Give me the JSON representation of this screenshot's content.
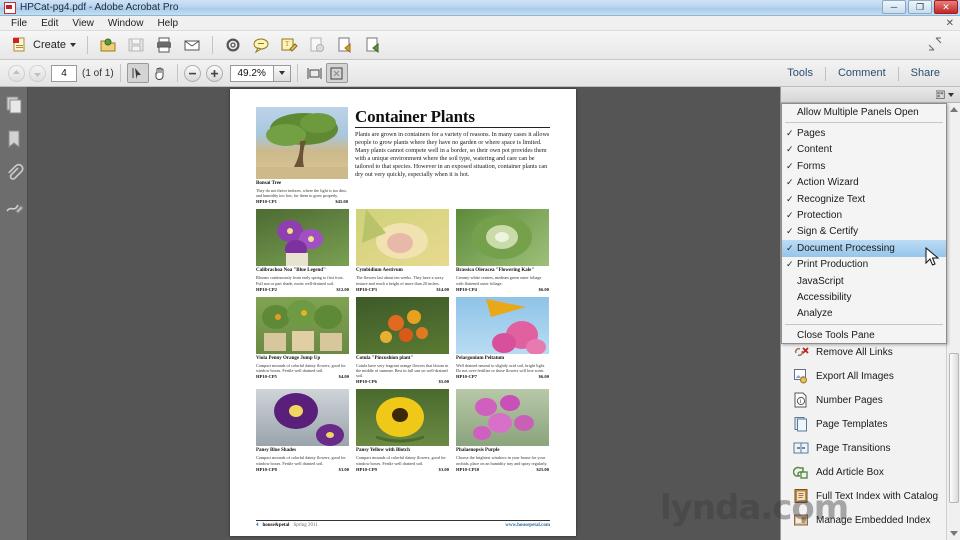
{
  "window": {
    "title": "HPCat-pg4.pdf - Adobe Acrobat Pro",
    "icon": "acrobat-icon",
    "minimize": "─",
    "maximize": "❐",
    "close": "✕",
    "menu_close": "✕"
  },
  "menubar": {
    "items": [
      "File",
      "Edit",
      "View",
      "Window",
      "Help"
    ]
  },
  "toolbar": {
    "create_label": "Create",
    "icons": [
      "create-pdf-icon",
      "open-file-icon",
      "save-icon",
      "print-icon",
      "email-icon",
      "settings-gear-icon",
      "comment-icon",
      "sign-icon",
      "secure-icon",
      "export-icon",
      "attach-icon"
    ]
  },
  "navbar": {
    "prev_page": "previous-page-icon",
    "next_page": "next-page-icon",
    "page_value": "4",
    "page_count": "(1 of 1)",
    "select_tool": "select-tool-icon",
    "hand_tool": "hand-tool-icon",
    "zoom_out": "zoom-out-icon",
    "zoom_in": "zoom-in-icon",
    "zoom_value": "49.2%",
    "fit_width": "fit-width-icon",
    "fit_page": "fit-page-icon",
    "tabs": [
      "Tools",
      "Comment",
      "Share"
    ]
  },
  "leftrail": {
    "items": [
      "page-thumbnails-icon",
      "bookmarks-icon",
      "attachments-icon",
      "signatures-icon"
    ]
  },
  "rightpanel": {
    "options_icon": "panel-options-icon",
    "dropdown": {
      "header": "Allow Multiple Panels Open",
      "items": [
        {
          "label": "Pages",
          "checked": true,
          "selected": false
        },
        {
          "label": "Content",
          "checked": true,
          "selected": false
        },
        {
          "label": "Forms",
          "checked": true,
          "selected": false
        },
        {
          "label": "Action Wizard",
          "checked": true,
          "selected": false
        },
        {
          "label": "Recognize Text",
          "checked": true,
          "selected": false
        },
        {
          "label": "Protection",
          "checked": true,
          "selected": false
        },
        {
          "label": "Sign & Certify",
          "checked": true,
          "selected": false
        },
        {
          "label": "Document Processing",
          "checked": true,
          "selected": true
        },
        {
          "label": "Print Production",
          "checked": true,
          "selected": false
        },
        {
          "label": "JavaScript",
          "checked": false,
          "selected": false
        },
        {
          "label": "Accessibility",
          "checked": false,
          "selected": false
        },
        {
          "label": "Analyze",
          "checked": false,
          "selected": false
        }
      ],
      "footer": "Close Tools Pane",
      "check_glyph": "✓"
    },
    "tools": [
      {
        "label": "Remove All Links",
        "icon": "remove-links-icon"
      },
      {
        "label": "Export All Images",
        "icon": "export-images-icon"
      },
      {
        "label": "Number Pages",
        "icon": "number-pages-icon"
      },
      {
        "label": "Page Templates",
        "icon": "page-templates-icon"
      },
      {
        "label": "Page Transitions",
        "icon": "page-transitions-icon"
      },
      {
        "label": "Add Article Box",
        "icon": "add-article-box-icon"
      },
      {
        "label": "Full Text Index with Catalog",
        "icon": "full-text-index-icon"
      },
      {
        "label": "Manage Embedded Index",
        "icon": "manage-embedded-index-icon"
      }
    ]
  },
  "document": {
    "title": "Container Plants",
    "intro": "Plants are grown in containers for a variety of reasons. In many cases it allows people to grow plants where they have no garden or where space is limited. Many plants cannot compete well in a border, so their own pot provides them with a unique environment where the soil type, watering and care can be tailored to that species. However in an exposed situation, container plants can dry out very quickly, especially when it is hot.",
    "hero": {
      "name": "Bonsai Tree",
      "desc": "They do not thrive indoors, where the light is too dim, and humidity too low, for them to grow properly.",
      "sku": "HP10-CP1",
      "price": "$45.00"
    },
    "entries": [
      {
        "name": "Calibrachoa Noa \"Blue Legend\"",
        "desc": "Blooms continuously from early spring to first frost. Full sun or part shade, moist well-drained soil.",
        "sku": "HP10-CP2",
        "price": "$12.00"
      },
      {
        "name": "Cymbidium Aestivum",
        "desc": "The flowers last about ten weeks. They have a waxy texture and reach a height of more than 20 inches.",
        "sku": "HP10-CP3",
        "price": "$14.00"
      },
      {
        "name": "Brassica Oleracea \"Flowering Kale\"",
        "desc": "Creamy-white centers, medium green outer foliage with flattened outer foliage.",
        "sku": "HP10-CP4",
        "price": "$6.00"
      },
      {
        "name": "Viola Penny Orange Jump Up",
        "desc": "Compact mounds of colorful dainty flowers, good for window boxes. Fertile well drained soil.",
        "sku": "HP10-CP5",
        "price": "$4.00"
      },
      {
        "name": "Cotula \"Pincushion plant\"",
        "desc": "Cotula have very fragrant orange flowers that bloom in the middle of summer. Best in full sun on well-drained soil.",
        "sku": "HP10-CP6",
        "price": "$5.00"
      },
      {
        "name": "Pelargonium Peltatum",
        "desc": "Well drained neutral to slightly acid soil, bright light. Do not over-fertilize or those flowers will lose scent.",
        "sku": "HP10-CP7",
        "price": "$6.00"
      },
      {
        "name": "Pansy Blue Shades",
        "desc": "Compact mounds of colorful dainty flowers, good for window boxes. Fertile well drained soil.",
        "sku": "HP10-CP8",
        "price": "$3.00"
      },
      {
        "name": "Pansy Yellow with Blotch",
        "desc": "Compact mounds of colorful dainty flowers, good for window boxes. Fertile well drained soil.",
        "sku": "HP10-CP9",
        "price": "$3.00"
      },
      {
        "name": "Phalaenopsis Purple",
        "desc": "Choose the brightest windows in your house for your orchids, place on an humidity tray and spray regularly.",
        "sku": "HP10-CP10",
        "price": "$25.00"
      }
    ],
    "footer": {
      "page_number": "4",
      "brand": "house&petal",
      "season": "Spring 2011",
      "url": "www.housepetal.com"
    }
  },
  "watermark": "lynda.com",
  "colors": {
    "accent": "#2b4d73",
    "selection": "#95c5ea",
    "canvas_bg": "#555555",
    "panel_bg": "#f2f2f2",
    "link": "#2b6ca3"
  }
}
